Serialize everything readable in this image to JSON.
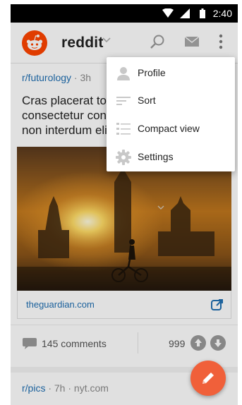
{
  "status_bar": {
    "time": "2:40"
  },
  "app_bar": {
    "brand": "reddit"
  },
  "post": {
    "subreddit": "r/futurology",
    "separator": " · ",
    "age": "3h",
    "title": "Cras placerat to\nconsectetur con\nnon interdum eli",
    "link_domain": "theguardian.com",
    "comments_label": "145 comments",
    "score": "999"
  },
  "post2": {
    "subreddit": "r/pics",
    "rest": " · 7h · nyt.com"
  },
  "menu": {
    "items": [
      {
        "label": "Profile",
        "icon": "profile-icon"
      },
      {
        "label": "Sort",
        "icon": "sort-icon"
      },
      {
        "label": "Compact view",
        "icon": "compact-view-icon"
      },
      {
        "label": "Settings",
        "icon": "settings-icon"
      }
    ]
  },
  "colors": {
    "accent": "#ff4500",
    "fab": "#f0603a",
    "link": "#1f6fb2"
  }
}
